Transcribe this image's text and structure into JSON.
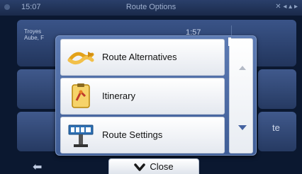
{
  "status_bar": {
    "time": "15:07",
    "title": "Route Options"
  },
  "background": {
    "location_line1": "Troyes",
    "location_line2": "Aube, F",
    "eta": "1:57",
    "right_partial_text": "te"
  },
  "menu": {
    "items": [
      {
        "label": "Route Alternatives",
        "icon": "route-alternatives-icon"
      },
      {
        "label": "Itinerary",
        "icon": "itinerary-icon"
      },
      {
        "label": "Route Settings",
        "icon": "route-settings-icon"
      }
    ]
  },
  "close_button": {
    "label": "Close"
  },
  "colors": {
    "modal_bg": "#4e6ca5",
    "list_bg": "#ffffff",
    "arrow_accent": "#4462a0"
  }
}
